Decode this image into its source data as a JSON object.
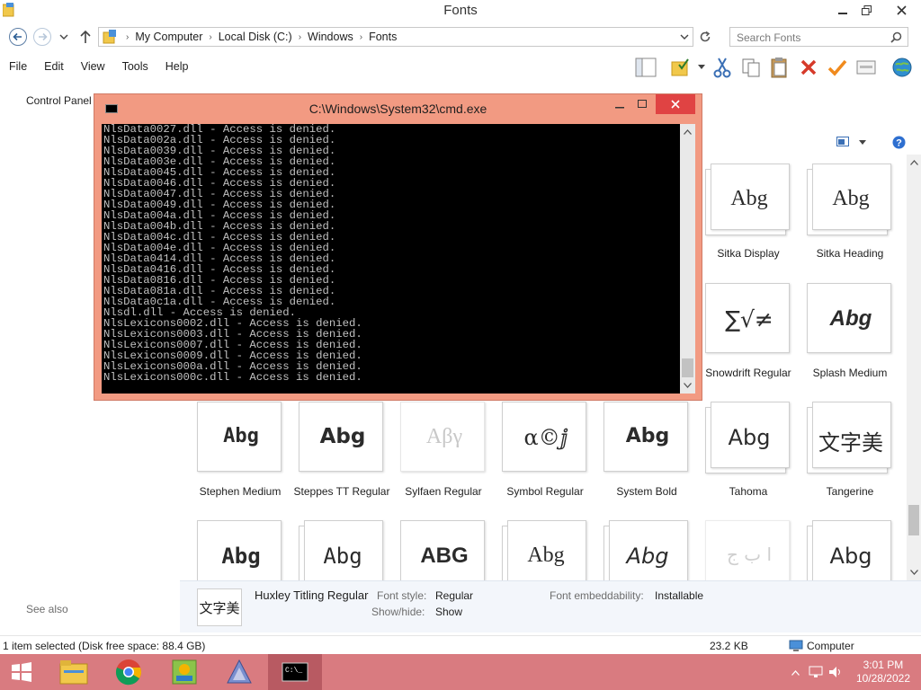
{
  "window": {
    "title": "Fonts"
  },
  "address": {
    "crumbs": [
      "My Computer",
      "Local Disk (C:)",
      "Windows",
      "Fonts"
    ],
    "search_placeholder": "Search Fonts"
  },
  "menu": [
    "File",
    "Edit",
    "View",
    "Tools",
    "Help"
  ],
  "left_pane": {
    "control_panel": "Control Panel",
    "see_also": "See also"
  },
  "cmd": {
    "title": "C:\\Windows\\System32\\cmd.exe",
    "lines": [
      "NlsData0027.dll - Access is denied.",
      "NlsData002a.dll - Access is denied.",
      "NlsData0039.dll - Access is denied.",
      "NlsData003e.dll - Access is denied.",
      "NlsData0045.dll - Access is denied.",
      "NlsData0046.dll - Access is denied.",
      "NlsData0047.dll - Access is denied.",
      "NlsData0049.dll - Access is denied.",
      "NlsData004a.dll - Access is denied.",
      "NlsData004b.dll - Access is denied.",
      "NlsData004c.dll - Access is denied.",
      "NlsData004e.dll - Access is denied.",
      "NlsData0414.dll - Access is denied.",
      "NlsData0416.dll - Access is denied.",
      "NlsData0816.dll - Access is denied.",
      "NlsData081a.dll - Access is denied.",
      "NlsData0c1a.dll - Access is denied.",
      "Nlsdl.dll - Access is denied.",
      "NlsLexicons0002.dll - Access is denied.",
      "NlsLexicons0003.dll - Access is denied.",
      "NlsLexicons0007.dll - Access is denied.",
      "NlsLexicons0009.dll - Access is denied.",
      "NlsLexicons000a.dll - Access is denied.",
      "NlsLexicons000c.dll - Access is denied."
    ]
  },
  "fonts": {
    "row1": [
      {
        "name": "Sitka Display",
        "sample": "Abg"
      },
      {
        "name": "Sitka Heading",
        "sample": "Abg"
      }
    ],
    "row2": [
      {
        "name": "Snowdrift Regular",
        "sample": "∑√≠"
      },
      {
        "name": "Splash Medium",
        "sample": "Abg"
      }
    ],
    "row3": [
      {
        "name": "Stephen Medium",
        "sample": "Abg"
      },
      {
        "name": "Steppes TT Regular",
        "sample": "Abg"
      },
      {
        "name": "Sylfaen Regular",
        "sample": "Αβγ"
      },
      {
        "name": "Symbol Regular",
        "sample": "α©ⅉ"
      },
      {
        "name": "System Bold",
        "sample": "Abg"
      },
      {
        "name": "Tahoma",
        "sample": "Abg"
      },
      {
        "name": "Tangerine",
        "sample": "文字美"
      }
    ],
    "row4": [
      {
        "sample": "Abg"
      },
      {
        "sample": "Abg"
      },
      {
        "sample": "ABG"
      },
      {
        "sample": "Abg"
      },
      {
        "sample": "Abg"
      },
      {
        "sample": "ا ب ج"
      },
      {
        "sample": "Abg"
      }
    ]
  },
  "details": {
    "thumb": "文字美",
    "name": "Huxley Titling Regular",
    "font_style_label": "Font style:",
    "font_style": "Regular",
    "show_hide_label": "Show/hide:",
    "show_hide": "Show",
    "embed_label": "Font embeddability:",
    "embed": "Installable"
  },
  "status": {
    "selection": "1 item selected (Disk free space: 88.4 GB)",
    "size": "23.2 KB",
    "location": "Computer"
  },
  "taskbar": {
    "time": "3:01 PM",
    "date": "10/28/2022"
  },
  "colors": {
    "taskbar": "#d97b80",
    "cmd_frame": "#f29a82",
    "close_red": "#e04343"
  }
}
